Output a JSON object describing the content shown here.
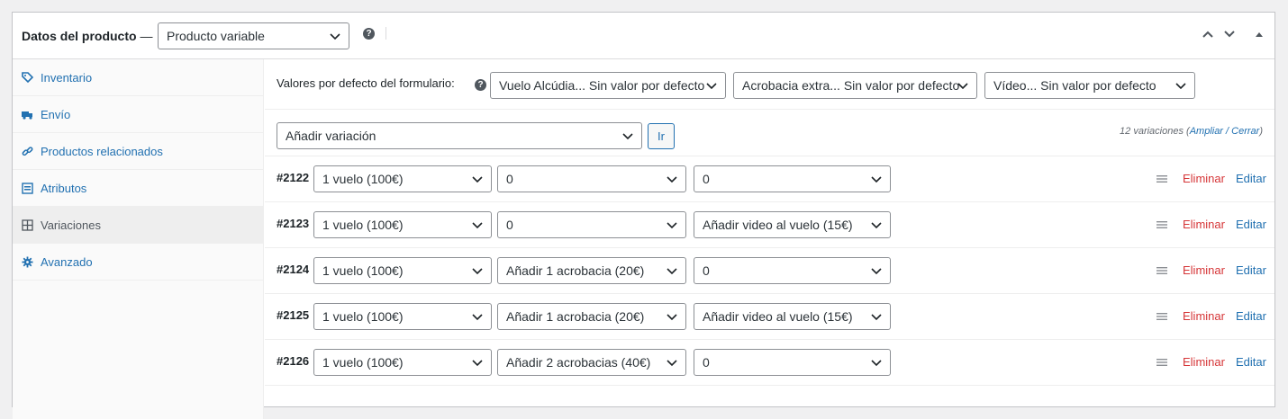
{
  "header": {
    "title": "Datos del producto",
    "dash": " —",
    "product_type": "Producto variable",
    "help": "?"
  },
  "sidebar": {
    "tabs": [
      {
        "label": "Inventario",
        "icon": "tag-icon"
      },
      {
        "label": "Envío",
        "icon": "truck-icon"
      },
      {
        "label": "Productos relacionados",
        "icon": "link-icon"
      },
      {
        "label": "Atributos",
        "icon": "list-icon"
      },
      {
        "label": "Variaciones",
        "icon": "grid-icon",
        "active": true
      },
      {
        "label": "Avanzado",
        "icon": "gear-icon"
      }
    ]
  },
  "defaults": {
    "label": "Valores por defecto del formulario:",
    "help": "?",
    "selects": [
      "Vuelo Alcúdia... Sin valor por defecto",
      "Acrobacia extra... Sin valor por defecto",
      "Vídeo... Sin valor por defecto"
    ]
  },
  "add_variation": {
    "select": "Añadir variación",
    "go_label": "Ir",
    "count_text": "12 variaciones (",
    "expand": "Ampliar",
    "sep": " / ",
    "close": "Cerrar",
    "close_paren": ")"
  },
  "variations": [
    {
      "id": "#2122",
      "v1": "1 vuelo (100€)",
      "v2": "0",
      "v3": "0"
    },
    {
      "id": "#2123",
      "v1": "1 vuelo (100€)",
      "v2": "0",
      "v3": "Añadir video al vuelo (15€)"
    },
    {
      "id": "#2124",
      "v1": "1 vuelo (100€)",
      "v2": "Añadir 1 acrobacia (20€)",
      "v3": "0"
    },
    {
      "id": "#2125",
      "v1": "1 vuelo (100€)",
      "v2": "Añadir 1 acrobacia (20€)",
      "v3": "Añadir video al vuelo (15€)"
    },
    {
      "id": "#2126",
      "v1": "1 vuelo (100€)",
      "v2": "Añadir 2 acrobacias (40€)",
      "v3": "0"
    }
  ],
  "row_actions": {
    "delete": "Eliminar",
    "edit": "Editar"
  },
  "colors": {
    "link": "#2271b1",
    "delete": "#d63638",
    "border": "#8c8f94"
  }
}
